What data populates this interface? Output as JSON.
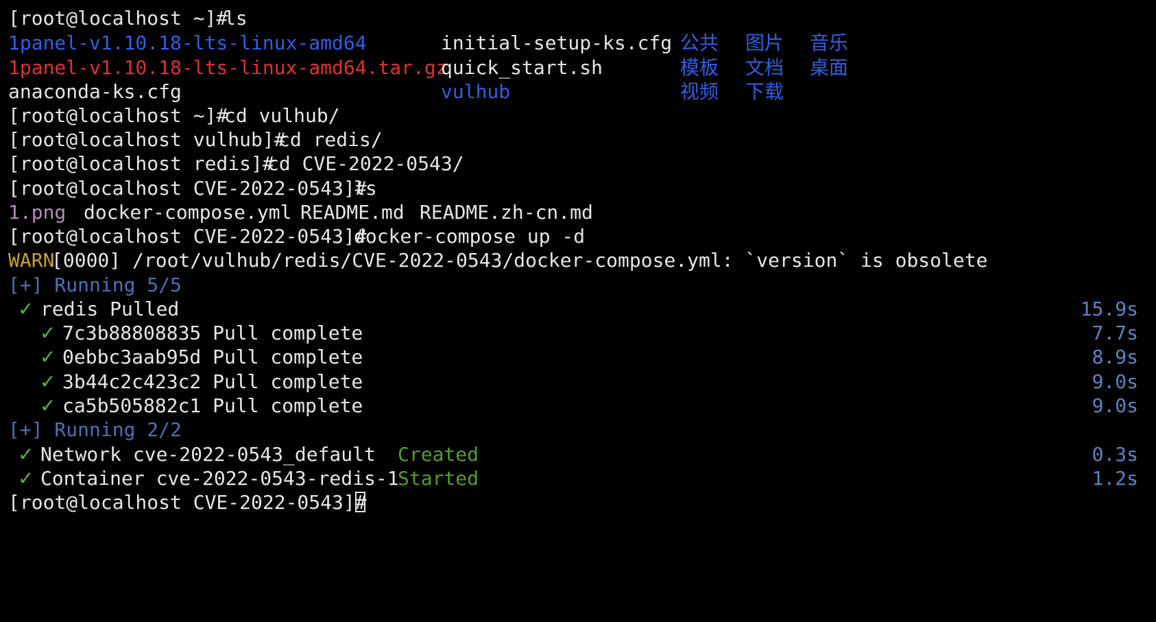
{
  "colors": {
    "background": "#000000",
    "text": "#e6e6e6",
    "directory": "#2f5fe6",
    "archive": "#e03030",
    "image": "#b78bb8",
    "warn": "#c9a227",
    "running": "#4a72b8",
    "check": "#5fb33a",
    "status": "#4ea02a",
    "time": "#5b84c4"
  },
  "prompt": {
    "home": "[root@localhost ~]# ",
    "vulhub": "[root@localhost vulhub]# ",
    "redis": "[root@localhost redis]# ",
    "cve": "[root@localhost CVE-2022-0543]# "
  },
  "commands": {
    "ls1": "ls",
    "cd_vulhub": "cd vulhub/",
    "cd_redis": "cd redis/",
    "cd_cve": "cd CVE-2022-0543/",
    "ls2": "ls",
    "compose": "docker-compose up -d"
  },
  "home_listing": {
    "row1": [
      "1panel-v1.10.18-lts-linux-amd64",
      "initial-setup-ks.cfg",
      "公共",
      "图片",
      "音乐"
    ],
    "row2": [
      "1panel-v1.10.18-lts-linux-amd64.tar.gz",
      "quick_start.sh",
      "模板",
      "文档",
      "桌面"
    ],
    "row3": [
      "anaconda-ks.cfg",
      "vulhub",
      "视频",
      "下载"
    ]
  },
  "cve_listing": [
    "1.png",
    "docker-compose.yml",
    "README.md",
    "README.zh-cn.md"
  ],
  "warn": {
    "tag": "WARN",
    "text": "[0000] /root/vulhub/redis/CVE-2022-0543/docker-compose.yml: `version` is obsolete"
  },
  "running1": "[+] Running 5/5",
  "check_mark": "✓",
  "pull_main": {
    "text": "redis Pulled",
    "time": "15.9s"
  },
  "pulls": [
    {
      "text": "7c3b88808835 Pull complete",
      "time": "7.7s"
    },
    {
      "text": "0ebbc3aab95d Pull complete",
      "time": "8.9s"
    },
    {
      "text": "3b44c2c423c2 Pull complete",
      "time": "9.0s"
    },
    {
      "text": "ca5b505882c1 Pull complete",
      "time": "9.0s"
    }
  ],
  "running2": "[+] Running 2/2",
  "resources": [
    {
      "text": "Network cve-2022-0543_default",
      "status": "Created",
      "time": "0.3s"
    },
    {
      "text": "Container cve-2022-0543-redis-1",
      "status": "Started",
      "time": "1.2s"
    }
  ]
}
